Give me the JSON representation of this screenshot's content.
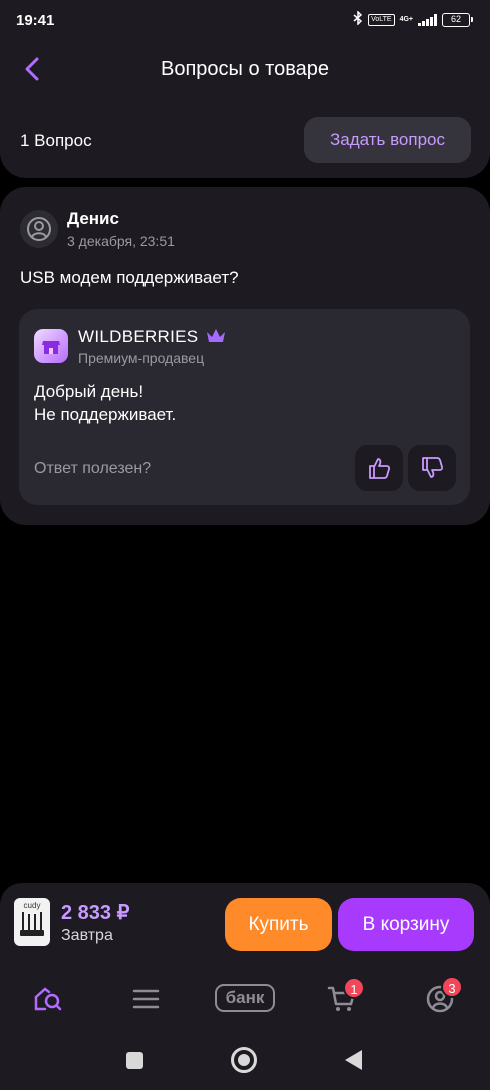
{
  "status_bar": {
    "time": "19:41",
    "bluetooth_icon": "bluetooth-icon",
    "volte": "VoLTE",
    "network": "4G+",
    "battery": "62"
  },
  "header": {
    "back_icon": "chevron-left-icon",
    "title": "Вопросы о товаре"
  },
  "summary": {
    "count_label": "1 Вопрос",
    "ask_button_label": "Задать вопрос"
  },
  "question": {
    "author": "Денис",
    "avatar_icon": "user-icon",
    "date": "3 декабря, 23:51",
    "text": "USB модем поддерживает?",
    "answer": {
      "seller_logo_icon": "store-icon",
      "seller_name": "WILDBERRIES",
      "crown_icon": "crown-icon",
      "seller_status": "Премиум-продавец",
      "line1": "Добрый день!",
      "line2": "Не поддерживает.",
      "helpful_label": "Ответ полезен?",
      "like_icon": "thumbs-up-icon",
      "dislike_icon": "thumbs-down-icon"
    }
  },
  "buy_panel": {
    "product_image": "router-thumbnail",
    "thumbnail_brand": "cudy",
    "price": "2 833 ₽",
    "delivery": "Завтра",
    "buy_label": "Купить",
    "cart_label": "В корзину"
  },
  "tabbar": {
    "home_icon": "home-search-icon",
    "catalog_icon": "menu-icon",
    "bank_label": "банк",
    "cart_icon": "cart-icon",
    "cart_badge": "1",
    "profile_icon": "profile-icon",
    "profile_badge": "3"
  },
  "colors": {
    "accent": "#a73afd",
    "accent_text": "#c79bff",
    "buy": "#ff8a2a",
    "badge": "#f2475a",
    "surface": "#1d1b21"
  }
}
